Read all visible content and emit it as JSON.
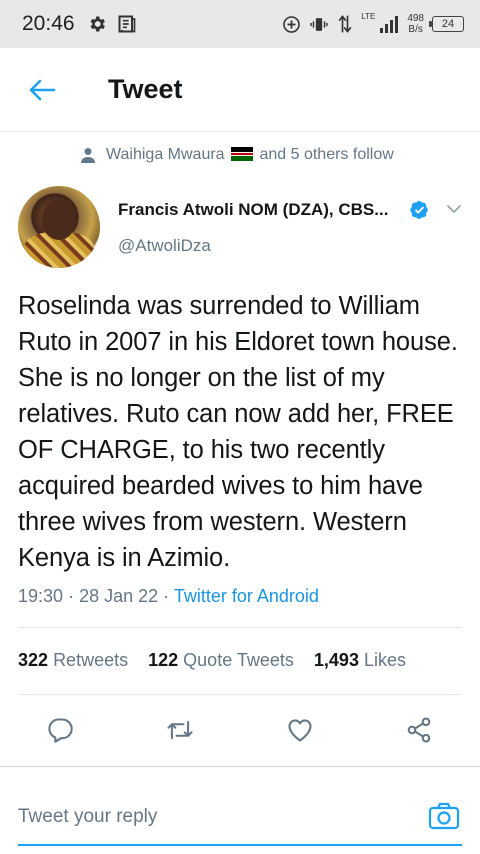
{
  "status_bar": {
    "time": "20:46",
    "network": "LTE",
    "speed_value": "498",
    "speed_unit": "B/s",
    "battery": "24",
    "icons": [
      "gear-icon",
      "notes-icon",
      "add-circle-icon",
      "vibrate-icon",
      "data-arrows-icon",
      "signal-icon"
    ]
  },
  "header": {
    "title": "Tweet",
    "back_icon": "arrow-left-icon"
  },
  "social_context": {
    "name": "Waihiga Mwaura",
    "suffix": "and 5 others follow",
    "flag": "kenya-flag"
  },
  "author": {
    "name": "Francis Atwoli NOM (DZA), CBS...",
    "handle": "@AtwoliDza",
    "verified": true
  },
  "tweet": {
    "text": "Roselinda was surrended to William Ruto in 2007 in his Eldoret town house. She is no longer on the list of my relatives. Ruto can now add her, FREE OF CHARGE, to his  two recently acquired bearded wives to him have three wives from western. Western Kenya is in Azimio.",
    "time": "19:30",
    "date": "28 Jan 22",
    "separator": "·",
    "source": "Twitter for Android"
  },
  "stats": {
    "retweets_count": "322",
    "retweets_label": "Retweets",
    "quotes_count": "122",
    "quotes_label": "Quote Tweets",
    "likes_count": "1,493",
    "likes_label": "Likes"
  },
  "actions": [
    "reply-icon",
    "retweet-icon",
    "like-icon",
    "share-icon"
  ],
  "reply": {
    "placeholder": "Tweet your reply"
  },
  "colors": {
    "accent": "#1da1f2",
    "link": "#1b95e0",
    "secondary_text": "#657786",
    "primary_text": "#14171a"
  }
}
